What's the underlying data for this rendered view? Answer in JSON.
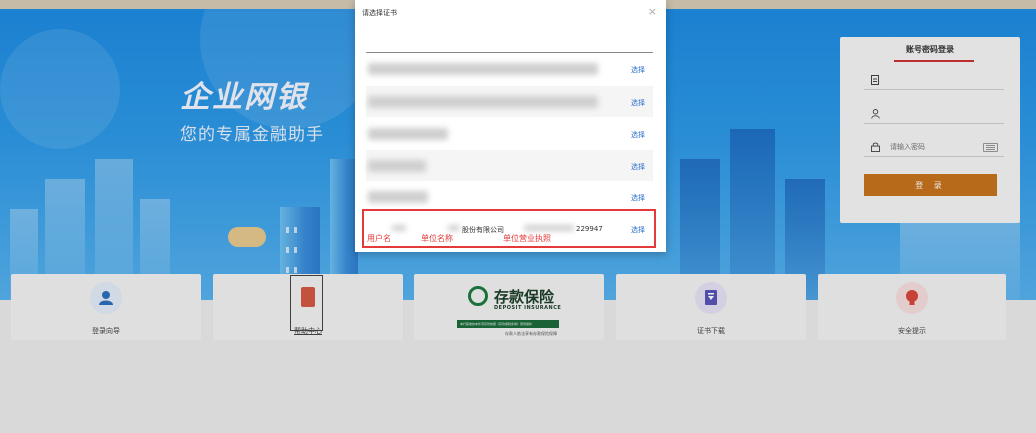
{
  "hero": {
    "slogan_title": "企业网银",
    "slogan_sub": "您的专属金融助手"
  },
  "login": {
    "title": "账号密码登录",
    "password_placeholder": "请输入密码",
    "button_label": "登 录"
  },
  "cards": [
    {
      "label": "登录向导"
    },
    {
      "label": "帮助中心"
    },
    {
      "label": ""
    },
    {
      "label": "证书下载"
    },
    {
      "label": "安全提示"
    }
  ],
  "deposit_insurance": {
    "cn": "存款保险",
    "en": "DEPOSIT INSURANCE",
    "bar_text": "本行吸收的本外币存款依照《存款保险条例》受到保护",
    "sub": "存款人依法享有存款保险保障"
  },
  "modal": {
    "title": "请选择证书",
    "close": "×",
    "rows": [
      {
        "select_label": "选择"
      },
      {
        "select_label": "选择"
      },
      {
        "select_label": "选择"
      },
      {
        "select_label": "选择"
      },
      {
        "select_label": "选择"
      },
      {
        "user": "",
        "company": "股份有限公司",
        "license": "229947",
        "select_label": "选择"
      }
    ]
  },
  "annotations": {
    "user_label": "用户名",
    "company_label": "单位名称",
    "license_label": "单位营业执照",
    "color": "#e43a3a"
  },
  "colors": {
    "hero_blue": "#1e8ce2",
    "login_button": "#c8741e",
    "link_blue": "#2a6fd0",
    "di_green": "#1c7c40"
  }
}
